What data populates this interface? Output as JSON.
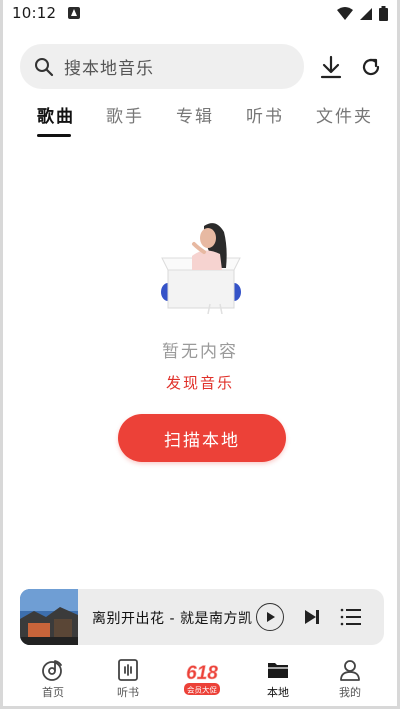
{
  "status_bar": {
    "time": "10:12"
  },
  "search": {
    "placeholder": "搜本地音乐"
  },
  "tabs": [
    {
      "label": "歌曲",
      "active": true
    },
    {
      "label": "歌手",
      "active": false
    },
    {
      "label": "专辑",
      "active": false
    },
    {
      "label": "听书",
      "active": false
    },
    {
      "label": "文件夹",
      "active": false
    }
  ],
  "empty_state": {
    "message": "暂无内容",
    "discover_link": "发现音乐",
    "scan_button": "扫描本地"
  },
  "player": {
    "now_playing": "离别开出花 - 就是南方凯"
  },
  "bottom_nav": [
    {
      "label": "首页",
      "icon": "home-disc-icon"
    },
    {
      "label": "听书",
      "icon": "audiobook-icon"
    },
    {
      "label": "本地",
      "icon": "folder-icon",
      "active": true
    },
    {
      "label": "我的",
      "icon": "profile-icon"
    }
  ],
  "promo": {
    "number": "618",
    "text": "会员大促"
  },
  "colors": {
    "accent": "#ec4138",
    "link": "#e0312a",
    "search_bg": "#efefef",
    "player_bg": "#ececec"
  }
}
